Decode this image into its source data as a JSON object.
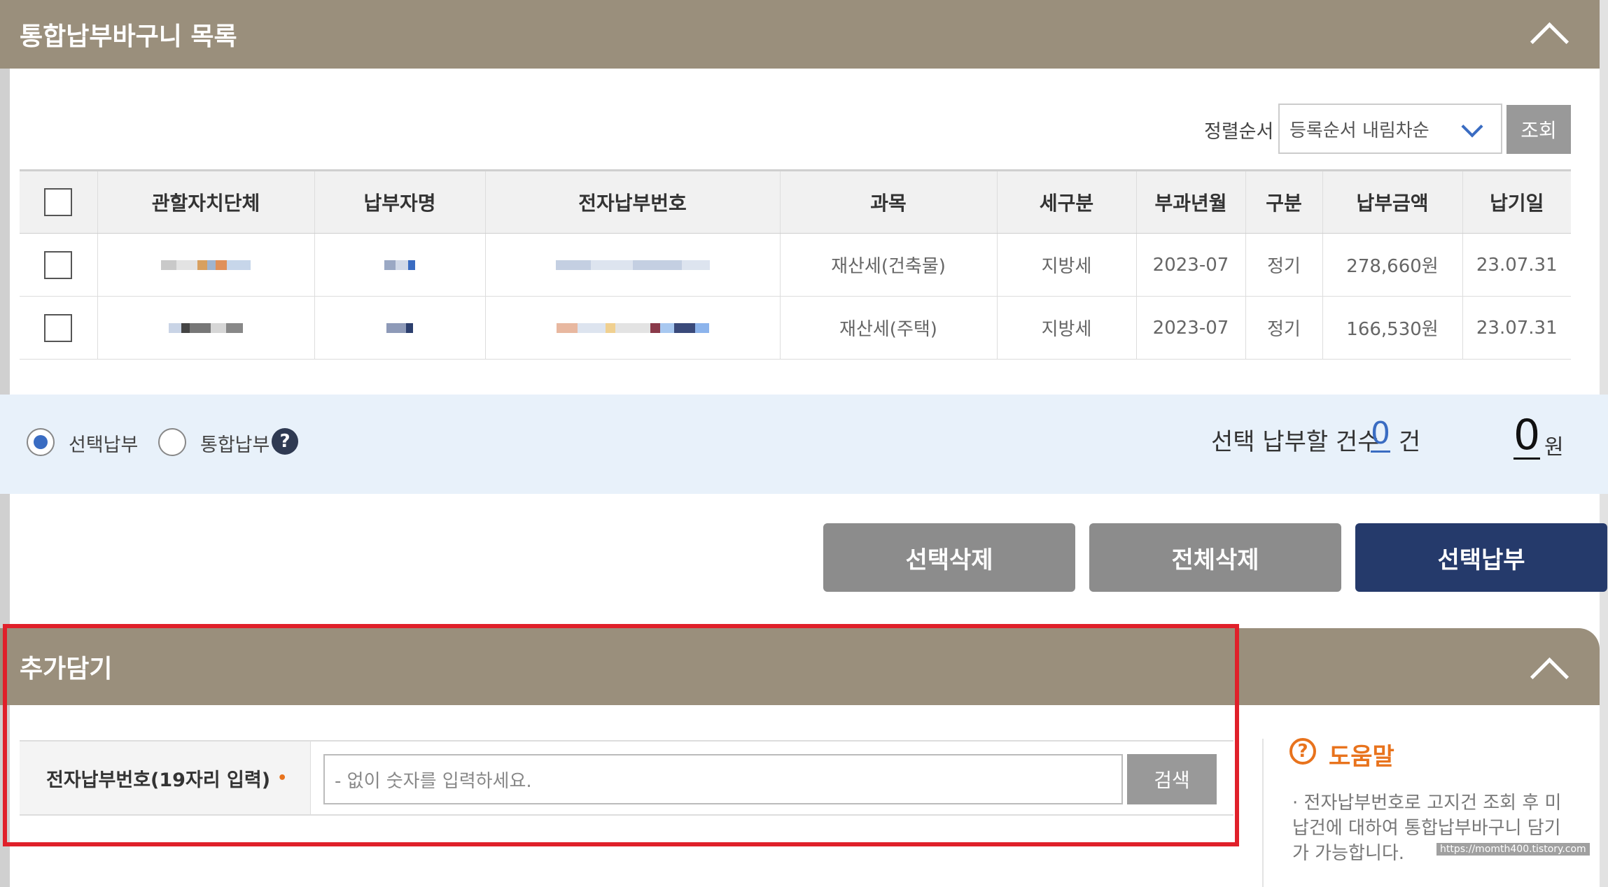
{
  "basket": {
    "title": "통합납부바구니 목록",
    "sort": {
      "label": "정렬순서",
      "selected": "등록순서 내림차순",
      "query_button": "조회"
    },
    "table": {
      "headers": [
        "관할자치단체",
        "납부자명",
        "전자납부번호",
        "과목",
        "세구분",
        "부과년월",
        "구분",
        "납부금액",
        "납기일"
      ],
      "rows": [
        {
          "subject": "재산세(건축물)",
          "tax_type": "지방세",
          "levy_month": "2023-07",
          "category": "정기",
          "amount": "278,660원",
          "due_date": "23.07.31"
        },
        {
          "subject": "재산세(주택)",
          "tax_type": "지방세",
          "levy_month": "2023-07",
          "category": "정기",
          "amount": "166,530원",
          "due_date": "23.07.31"
        }
      ]
    },
    "payment_mode": {
      "option_selected": "선택납부",
      "option_integrated": "통합납부",
      "help_icon": "?",
      "count_label": "선택 납부할 건수",
      "count": "0",
      "count_unit": "건",
      "amount": "0",
      "amount_unit": "원"
    },
    "actions": {
      "delete_selected": "선택삭제",
      "delete_all": "전체삭제",
      "pay_selected": "선택납부"
    }
  },
  "add": {
    "title": "추가담기",
    "field_label": "전자납부번호(19자리 입력)",
    "required_mark": "•",
    "placeholder": "- 없이 숫자를 입력하세요.",
    "search_button": "검색",
    "help": {
      "icon": "?",
      "title": "도움말",
      "text": "· 전자납부번호로 고지건 조회 후 미납건에 대하여 통합납부바구니 담기가 가능합니다."
    }
  },
  "watermark": "https://momth400.tistory.com",
  "colors": {
    "header": "#9a8f7c",
    "accent": "#3a6cc2",
    "primary_button": "#253a6b",
    "highlight_box": "#e0202a",
    "help_orange": "#e8731d"
  },
  "icons": {
    "collapse": "chevron-up-icon",
    "dropdown": "chevron-down-icon",
    "help": "question-circle-icon"
  }
}
